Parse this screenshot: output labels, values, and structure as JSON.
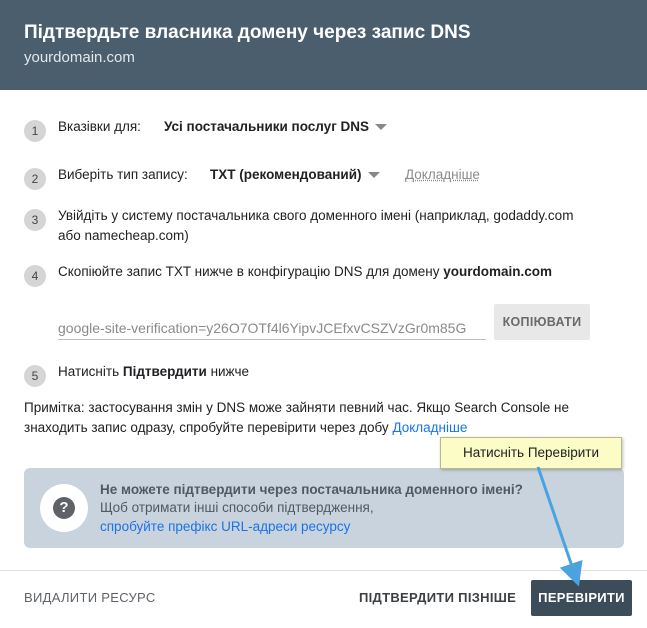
{
  "dialog": {
    "title": "Підтвердьте власника домену через запис DNS",
    "subtitle": "yourdomain.com"
  },
  "steps": [
    {
      "number": "1",
      "label": "Вказівки для:",
      "dropdown_value": "Усі постачальники послуг DNS"
    },
    {
      "number": "2",
      "label": "Виберіть тип запису:",
      "dropdown_value": "TXT (рекомендований)",
      "link": "Докладніше"
    },
    {
      "number": "3",
      "line1": "Увійдіть у систему постачальника свого доменного імені (наприклад, godaddy.com",
      "line2": "або namecheap.com)"
    },
    {
      "number": "4",
      "text": "Скопіюйте запис TXT нижче в конфігурацію DNS для домену ",
      "domain": "yourdomain.com"
    },
    {
      "number": "5",
      "text_before": "Натисніть ",
      "text_bold": "Підтвердити",
      "text_after": " нижче"
    }
  ],
  "record": {
    "value": "google-site-verification=y26O7OTf4l6YipvJCEfxvCSZVzGr0m85G",
    "copy_label": "КОПІЮВАТИ"
  },
  "note": {
    "text": "Примітка: застосування змін у DNS може зайняти певний час. Якщо Search Console не знаходить запис одразу, спробуйте перевірити через добу ",
    "link": "Докладніше"
  },
  "info_box": {
    "title": "Не можете підтвердити через постачальника доменного імені?",
    "line": "Щоб отримати інші способи підтвердження,",
    "link": "спробуйте префікс URL-адреси ресурсу",
    "icon": "help-icon"
  },
  "footer": {
    "delete_label": "ВИДАЛИТИ РЕСУРС",
    "later_label": "ПІДТВЕРДИТИ ПІЗНІШЕ",
    "verify_label": "ПЕРЕВІРИТИ"
  },
  "tooltip": {
    "text": "Натисніть Перевірити"
  },
  "colors": {
    "header_bg": "#4a5e6d",
    "link": "#1a73e8",
    "verify_bg": "#3d4c59",
    "info_bg": "#c8d3dd",
    "tooltip_bg": "#fbfcc6",
    "arrow": "#4aa3df"
  }
}
